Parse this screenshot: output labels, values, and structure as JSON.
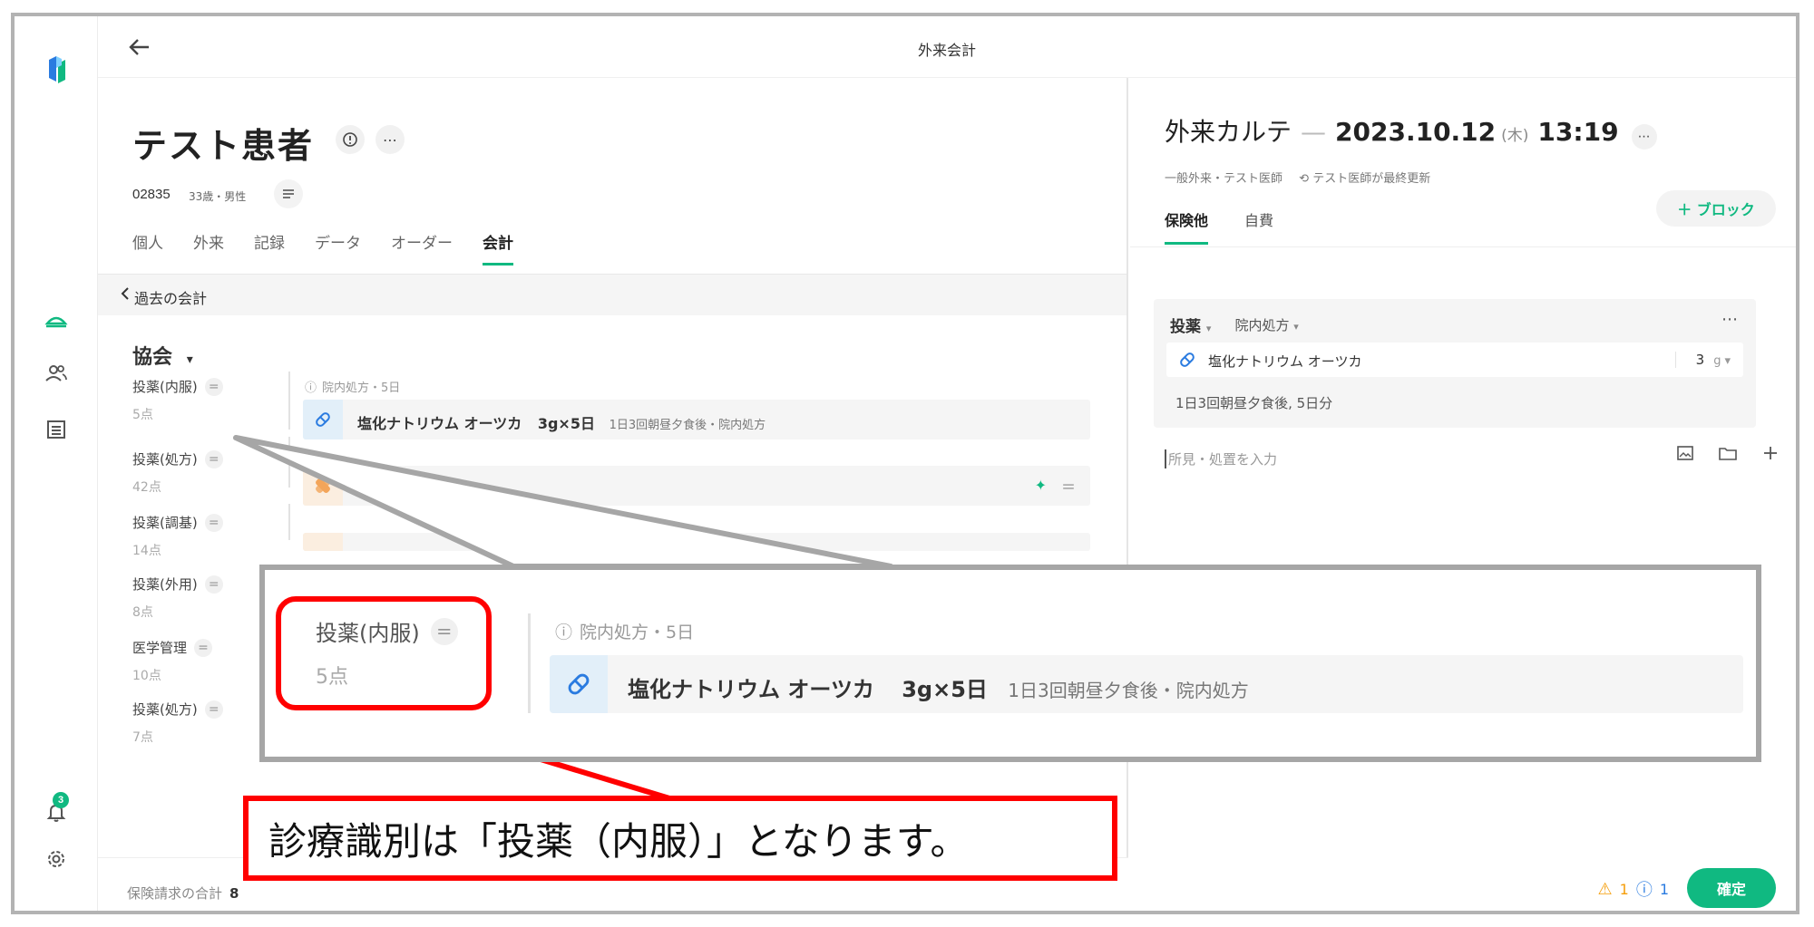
{
  "app": {
    "title": "外来会計",
    "colors": {
      "accent": "#10b981",
      "annotation_red": "#ff0000",
      "zoom_border": "#a6a6a6"
    }
  },
  "rail": {
    "notification_badge": "3",
    "icons": [
      "logo-icon",
      "queue-icon",
      "patients-icon",
      "list-icon",
      "bell-icon",
      "gear-icon"
    ]
  },
  "patient": {
    "name": "テスト患者",
    "id": "02835",
    "meta": "33歳・男性"
  },
  "tabs": [
    {
      "label": "個人"
    },
    {
      "label": "外来"
    },
    {
      "label": "記録"
    },
    {
      "label": "データ"
    },
    {
      "label": "オーダー"
    },
    {
      "label": "会計",
      "active": true
    }
  ],
  "subbar": {
    "back_label": "過去の会計"
  },
  "billing": {
    "section_title": "協会",
    "categories": [
      {
        "label": "投薬(内服)",
        "points": "5点"
      },
      {
        "label": "投薬(処方)",
        "points": "42点"
      },
      {
        "label": "投薬(調基)",
        "points": "14点"
      },
      {
        "label": "投薬(外用)",
        "points": "8点"
      },
      {
        "label": "医学管理",
        "points": "10点"
      },
      {
        "label": "投薬(処方)",
        "points": "7点"
      }
    ],
    "first_item": {
      "note": "院内処方・5日",
      "name": "塩化ナトリウム オーツカ",
      "dose": "3g×5日",
      "detail": "1日3回朝昼夕食後・院内処方"
    }
  },
  "footer": {
    "label": "保険請求の合計",
    "value": "8"
  },
  "karte": {
    "title": "外来カルテ",
    "dash": "—",
    "date": "2023.10.12",
    "day_of_week": "(木)",
    "time": "13:19",
    "meta_type": "一般外来・テスト医師",
    "meta_updated": "テスト医師が最終更新",
    "block_button": "＋ ブロック",
    "tabs": [
      {
        "label": "保険他",
        "active": true
      },
      {
        "label": "自費"
      }
    ],
    "order": {
      "type": "投薬",
      "subtype": "院内処方",
      "drug": "塩化ナトリウム オーツカ",
      "qty": "3",
      "unit": "g",
      "usage": "1日3回朝昼夕食後, 5日分"
    },
    "input_placeholder": "所見・処置を入力",
    "warnings": "1",
    "infos": "1",
    "confirm_label": "確定"
  },
  "annotation": {
    "zoom": {
      "label": "投薬(内服)",
      "points": "5点",
      "note": "院内処方・5日",
      "name": "塩化ナトリウム オーツカ",
      "dose": "3g×5日",
      "detail": "1日3回朝昼夕食後・院内処方"
    },
    "caption": "診療識別は「投薬（内服）」となります。"
  }
}
